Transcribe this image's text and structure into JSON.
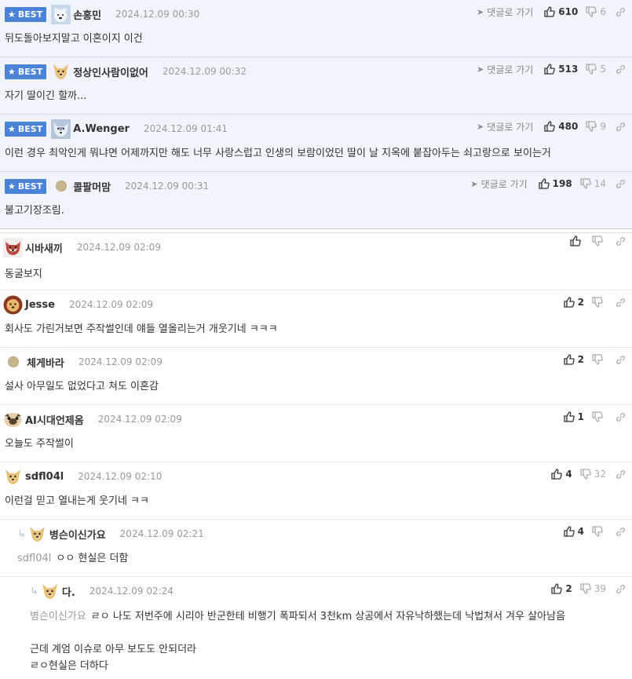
{
  "best_comments": [
    {
      "badge": "BEST",
      "nick": "손홍민",
      "time": "2024.12.09 00:30",
      "reply_link": "댓글로 가기",
      "likes": "610",
      "dislikes": "6",
      "text": "뒤도돌아보지말고 이혼이지 이건",
      "avatar": "polar-bear"
    },
    {
      "badge": "BEST",
      "nick": "정상인사람이없어",
      "time": "2024.12.09 00:32",
      "reply_link": "댓글로 가기",
      "likes": "513",
      "dislikes": "5",
      "text": "자기 딸이긴 할까...",
      "avatar": "dog"
    },
    {
      "badge": "BEST",
      "nick": "A.Wenger",
      "time": "2024.12.09 01:41",
      "reply_link": "댓글로 가기",
      "likes": "480",
      "dislikes": "9",
      "text": "이런 경우 최악인게 뭐냐면 어제까지만 해도 너무 사랑스럽고 인생의 보람이었던 딸이 날 지옥에 붙잡아두는 쇠고랑으로 보이는거",
      "avatar": "wolf"
    },
    {
      "badge": "BEST",
      "nick": "콜팔머맘",
      "time": "2024.12.09 00:31",
      "reply_link": "댓글로 가기",
      "likes": "198",
      "dislikes": "14",
      "text": "불고기장조림.",
      "avatar": "dot"
    }
  ],
  "comments": [
    {
      "nick": "시바새끼",
      "time": "2024.12.09 02:09",
      "likes": "",
      "dislikes": "",
      "text": "동굴보지",
      "avatar": "shiba"
    },
    {
      "nick": "Jesse",
      "time": "2024.12.09 02:09",
      "likes": "2",
      "dislikes": "",
      "text": "회사도 가린거보면 주작썰인데 얘들 열올리는거 개웃기네 ㅋㅋㅋ",
      "avatar": "lion"
    },
    {
      "nick": "체게바라",
      "time": "2024.12.09 02:09",
      "likes": "2",
      "dislikes": "",
      "text": "설사 아무일도 없었다고 쳐도 이혼감",
      "avatar": "dot"
    },
    {
      "nick": "AI시대언제옴",
      "time": "2024.12.09 02:09",
      "likes": "1",
      "dislikes": "",
      "text": "오늘도 주작썰이",
      "avatar": "pug"
    },
    {
      "nick": "sdfl04l",
      "time": "2024.12.09 02:10",
      "likes": "4",
      "dislikes": "32",
      "text": "이런걸 믿고 열내는게 웃기네 ㅋㅋ",
      "avatar": "dog"
    }
  ],
  "replies": [
    {
      "nick": "병슨이신가요",
      "time": "2024.12.09 02:21",
      "likes": "4",
      "dislikes": "",
      "mention": "sdfl04l",
      "text": "ㅇㅇ 현실은 더함",
      "avatar": "dog"
    },
    {
      "nick": "다.",
      "time": "2024.12.09 02:24",
      "likes": "2",
      "dislikes": "39",
      "mention": "병슨이신가요",
      "text": "ㄹㅇ 나도 저번주에 시리아 반군한테 비행기 폭파되서 3천km 상공에서 자유낙하했는데 낙법쳐서 겨우 살아남음",
      "text2": "근데 계엄 이슈로 아무 보도도 안되더라",
      "text3": "ㄹㅇ현실은 더하다",
      "avatar": "dog"
    }
  ],
  "colors": {
    "best_badge": "#4b83d8",
    "best_bg": "#f2f4fb"
  }
}
